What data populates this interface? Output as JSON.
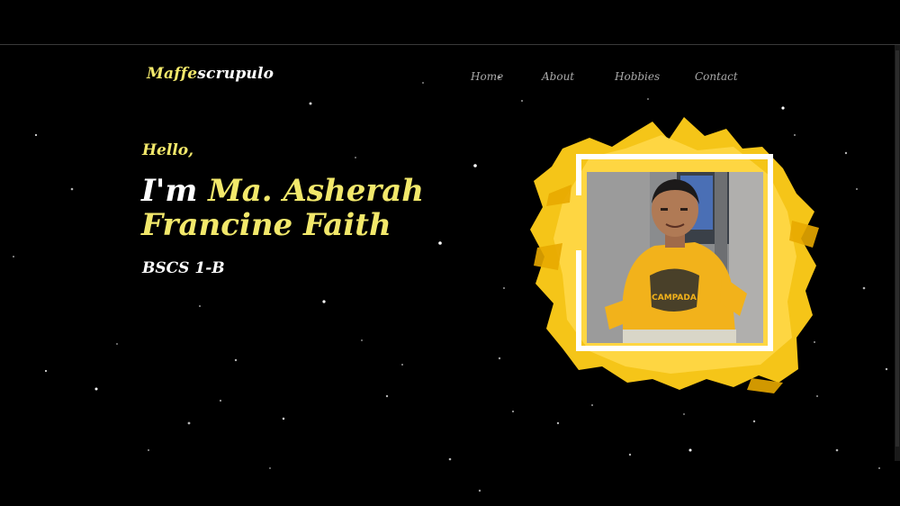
{
  "header": {
    "brand_accent": "Maffe",
    "brand_rest": "scrupulo"
  },
  "nav": {
    "items": [
      {
        "label": "Home"
      },
      {
        "label": "About"
      },
      {
        "label": "Hobbies"
      },
      {
        "label": "Contact"
      }
    ]
  },
  "hero": {
    "greeting": "Hello,",
    "intro": "I'm",
    "name_line1": "Ma. Asherah",
    "name_line2": "Francine Faith",
    "course": "BSCS 1-B"
  },
  "photo": {
    "shirt_text": "CAMPADA"
  },
  "colors": {
    "background": "#000000",
    "accent_yellow": "#f2e86b",
    "splash_yellow": "#f5c518",
    "nav_text": "#a9a9a9",
    "white": "#ffffff"
  },
  "icons": {
    "photo": "profile-photo"
  }
}
